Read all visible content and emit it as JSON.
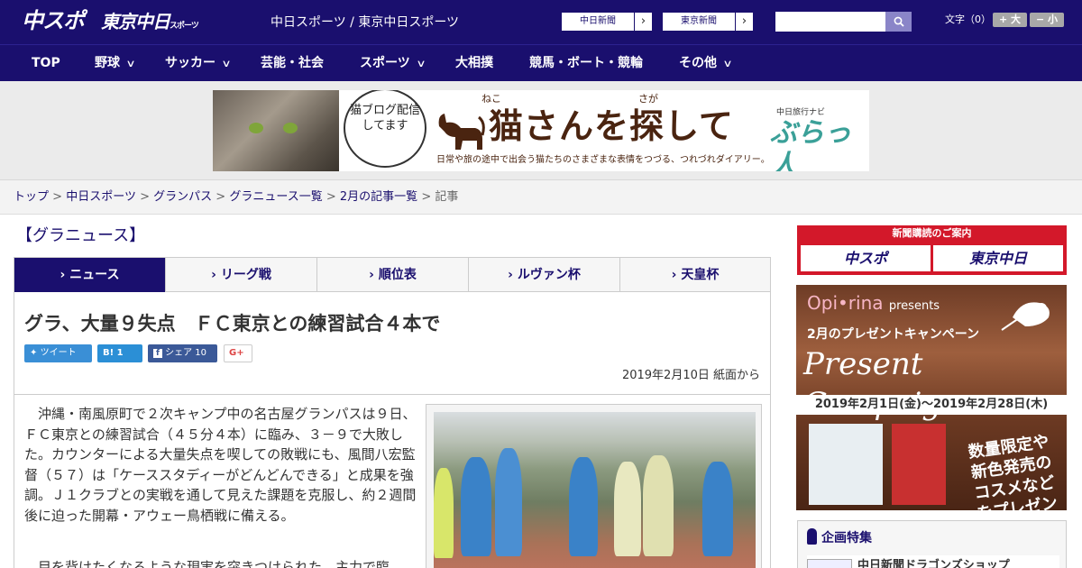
{
  "header": {
    "logo_chuspo": "中スポ",
    "logo_tokyo": "東京中日",
    "logo_tokyo_small": "スポーツ",
    "site_name": "中日スポーツ / 東京中日スポーツ",
    "link_chunichi": "中日新聞",
    "link_tokyo": "東京新聞",
    "search_placeholder": "",
    "font_size_label": "文字（0）",
    "font_larger": "+ 大",
    "font_smaller": "− 小"
  },
  "nav": {
    "items": [
      {
        "label": "TOP",
        "has_menu": false
      },
      {
        "label": "野球",
        "has_menu": true
      },
      {
        "label": "サッカー",
        "has_menu": true
      },
      {
        "label": "芸能・社会",
        "has_menu": false
      },
      {
        "label": "スポーツ",
        "has_menu": true
      },
      {
        "label": "大相撲",
        "has_menu": false
      },
      {
        "label": "競馬・ボート・競輪",
        "has_menu": false
      },
      {
        "label": "その他",
        "has_menu": true
      }
    ]
  },
  "banner": {
    "bubble_text": "猫ブログ配信してます",
    "title": "猫さんを探して",
    "ruby_1": "ねこ",
    "ruby_2": "さが",
    "subtitle": "日常や旅の途中で出会う猫たちのさまざまな表情をつづる、つれづれダイアリー。",
    "navi_label": "中日旅行ナビ",
    "brand": "ぶらっ人"
  },
  "breadcrumb": {
    "items": [
      "トップ",
      "中日スポーツ",
      "グランパス",
      "グラニュース一覧",
      "2月の記事一覧"
    ],
    "current": "記事",
    "separator": ">"
  },
  "section": {
    "title": "【グラニュース】"
  },
  "tabs": [
    {
      "label": "ニュース",
      "active": true
    },
    {
      "label": "リーグ戦",
      "active": false
    },
    {
      "label": "順位表",
      "active": false
    },
    {
      "label": "ルヴァン杯",
      "active": false
    },
    {
      "label": "天皇杯",
      "active": false
    }
  ],
  "article": {
    "headline": "グラ、大量９失点　ＦＣ東京との練習試合４本で",
    "share": {
      "tweet": "ツイート",
      "hatena_count": "1",
      "facebook": "シェア",
      "facebook_count": "10",
      "gplus": "G+"
    },
    "date": "2019年2月10日 紙面から",
    "paragraph_1": "　沖縄・南風原町で２次キャンプ中の名古屋グランパスは９日、ＦＣ東京との練習試合（４５分４本）に臨み、３－９で大敗した。カウンターによる大量失点を喫しての敗戦にも、風間八宏監督（５７）は「ケーススタディーがどんどんできる」と成果を強調。Ｊ１クラブとの実戦を通して見えた課題を克服し、約２週間後に迫った開幕・アウェー鳥栖戦に備える。",
    "paragraph_2": "　目を背けたくなるような現実を突きつけられた。主力で臨"
  },
  "sidebar": {
    "subscribe_title": "新聞購読のご案内",
    "subscribe_chuspo": "中スポ",
    "subscribe_tokyo": "東京中日",
    "ad": {
      "brand": "Opi•rina",
      "brand_suffix": "presents",
      "line1": "2月のプレゼントキャンペーン",
      "line2": "Present Campaign",
      "dates": "2019年2月1日(金)～2019年2月28日(木)",
      "promo": "数量限定や新色発売のコスメなどをプレゼント!"
    },
    "feature_title": "企画特集",
    "feature_item": "中日新聞ドラゴンズショップ"
  },
  "colors": {
    "brand_navy": "#1a0f6e",
    "accent_red": "#d3182a",
    "twitter": "#3a8fd6",
    "hatena": "#2b8fd6",
    "facebook": "#3b5998"
  }
}
